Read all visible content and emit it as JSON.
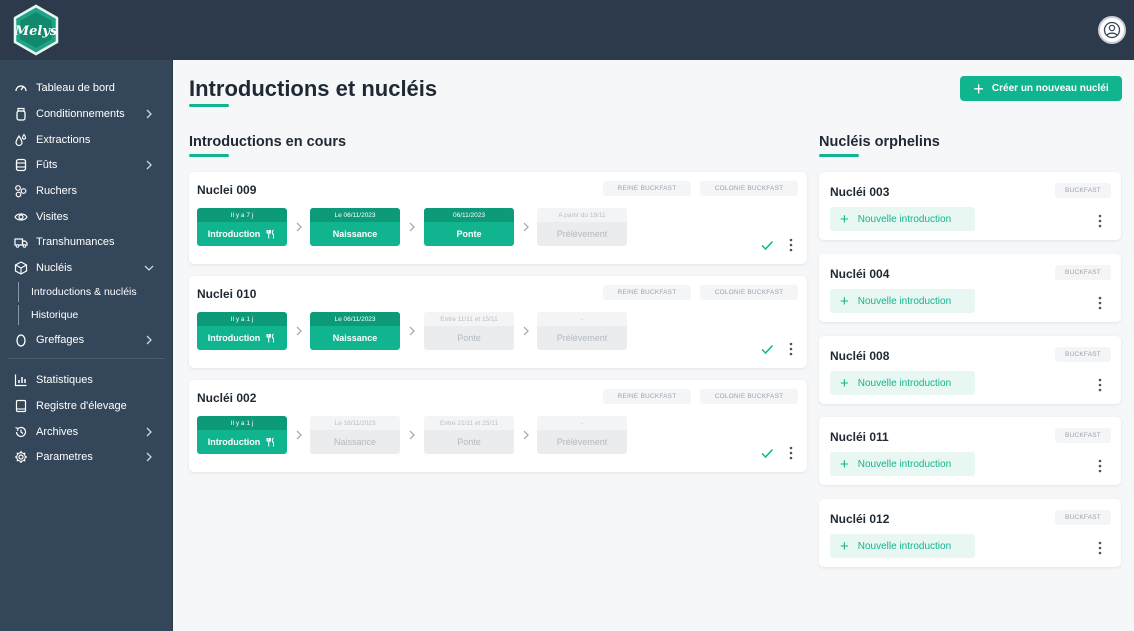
{
  "app": {
    "logo_text": "Melys"
  },
  "sidebar": {
    "items": [
      {
        "label": "Tableau de bord",
        "icon": "gauge-icon",
        "chevron": ""
      },
      {
        "label": "Conditionnements",
        "icon": "jar-icon",
        "chevron": "right"
      },
      {
        "label": "Extractions",
        "icon": "drops-icon",
        "chevron": ""
      },
      {
        "label": "Fûts",
        "icon": "barrel-icon",
        "chevron": "right"
      },
      {
        "label": "Ruchers",
        "icon": "hive-icon",
        "chevron": ""
      },
      {
        "label": "Visites",
        "icon": "eye-icon",
        "chevron": ""
      },
      {
        "label": "Transhumances",
        "icon": "truck-icon",
        "chevron": ""
      },
      {
        "label": "Nucléis",
        "icon": "box-icon",
        "chevron": "down"
      },
      {
        "label": "Greffages",
        "icon": "egg-icon",
        "chevron": "right"
      },
      {
        "label": "Statistiques",
        "icon": "chart-icon",
        "chevron": ""
      },
      {
        "label": "Registre d'élevage",
        "icon": "book-icon",
        "chevron": ""
      },
      {
        "label": "Archives",
        "icon": "history-icon",
        "chevron": "right"
      },
      {
        "label": "Parametres",
        "icon": "gear-icon",
        "chevron": "right"
      }
    ],
    "subitems": [
      "Introductions & nucléis",
      "Historique"
    ]
  },
  "header": {
    "title": "Introductions et nucléis",
    "create_button": "Créer un nouveau nucléi"
  },
  "introductions": {
    "section_title": "Introductions en cours",
    "cards": [
      {
        "title": "Nuclei 009",
        "tags": [
          "REINE BUCKFAST",
          "COLONIE BUCKFAST"
        ],
        "steps": [
          {
            "head": "Il y a 7 j",
            "label": "Introduction",
            "state": "done"
          },
          {
            "head": "Le 06/11/2023",
            "label": "Naissance",
            "state": "done"
          },
          {
            "head": "06/11/2023",
            "label": "Ponte",
            "state": "done"
          },
          {
            "head": "A partir du 18/11",
            "label": "Prélèvement",
            "state": "pending"
          }
        ]
      },
      {
        "title": "Nuclei 010",
        "tags": [
          "REINE BUCKFAST",
          "COLONIE BUCKFAST"
        ],
        "steps": [
          {
            "head": "Il y a 1 j",
            "label": "Introduction",
            "state": "done"
          },
          {
            "head": "Le 06/11/2023",
            "label": "Naissance",
            "state": "done"
          },
          {
            "head": "Entre 11/11 et 15/11",
            "label": "Ponte",
            "state": "pending"
          },
          {
            "head": "-",
            "label": "Prélèvement",
            "state": "pending"
          }
        ]
      },
      {
        "title": "Nucléi 002",
        "tags": [
          "REINE BUCKFAST",
          "COLONIE BUCKFAST"
        ],
        "steps": [
          {
            "head": "Il y a 1 j",
            "label": "Introduction",
            "state": "done"
          },
          {
            "head": "Le 16/11/2023",
            "label": "Naissance",
            "state": "pending"
          },
          {
            "head": "Entre 21/11 et 25/11",
            "label": "Ponte",
            "state": "pending"
          },
          {
            "head": "-",
            "label": "Prélèvement",
            "state": "pending"
          }
        ]
      }
    ]
  },
  "orphans": {
    "section_title": "Nucléis orphelins",
    "new_intro_label": "Nouvelle introduction",
    "cards": [
      {
        "title": "Nucléi 003",
        "tag": "BUCKFAST"
      },
      {
        "title": "Nucléi 004",
        "tag": "BUCKFAST"
      },
      {
        "title": "Nucléi 008",
        "tag": "BUCKFAST"
      },
      {
        "title": "Nucléi 011",
        "tag": "BUCKFAST"
      },
      {
        "title": "Nucléi 012",
        "tag": "BUCKFAST"
      }
    ]
  },
  "colors": {
    "accent": "#10b58f",
    "accent_dark": "#0d9a78",
    "sidebar_bg": "#34465a",
    "topbar_bg": "#2c3a4c"
  }
}
